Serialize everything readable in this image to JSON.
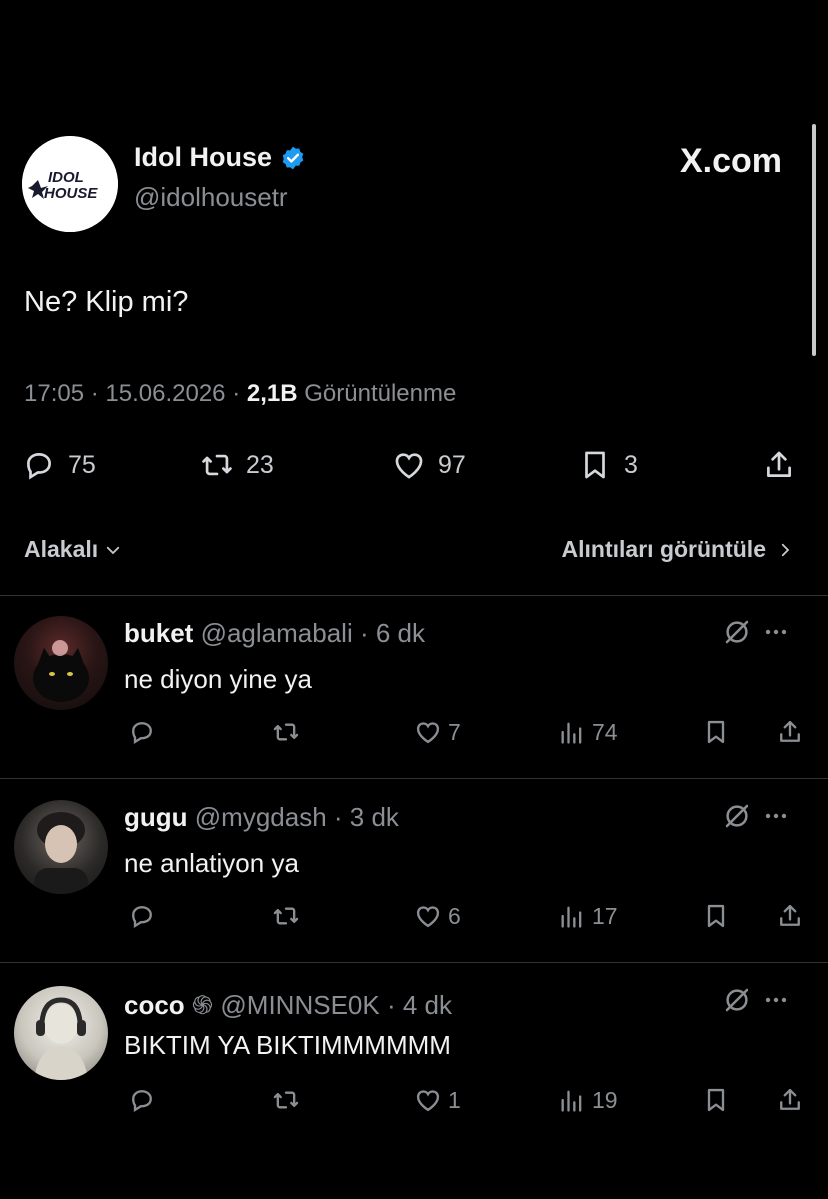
{
  "header": {
    "display_name": "Idol House",
    "handle": "@idolhousetr",
    "site": "X.com",
    "logo_text": "IDOL HOUSE"
  },
  "tweet": {
    "text": "Ne? Klip mi?",
    "time": "17:05",
    "date": "15.06.2026",
    "views": "2,1B",
    "views_label": "Görüntülenme",
    "replies": "75",
    "retweets": "23",
    "likes": "97",
    "bookmarks": "3"
  },
  "filters": {
    "sort_label": "Alakalı",
    "quotes_label": "Alıntıları görüntüle"
  },
  "replies": [
    {
      "name": "buket",
      "handle": "@aglamabali",
      "time": "6 dk",
      "text": "ne diyon yine ya",
      "likes": "7",
      "views": "74"
    },
    {
      "name": "gugu",
      "handle": "@mygdash",
      "time": "3 dk",
      "text": "ne anlatiyon ya",
      "likes": "6",
      "views": "17"
    },
    {
      "name": "coco",
      "name_suffix": "֍",
      "handle": "@MINNSE0K",
      "time": "4 dk",
      "text": "BIKTIM YA BIKTIMMMMMM",
      "likes": "1",
      "views": "19"
    }
  ],
  "colors": {
    "background": "#000000",
    "verified": "#1d9bf0",
    "muted": "#8b8f94",
    "divider": "#2f3336"
  }
}
